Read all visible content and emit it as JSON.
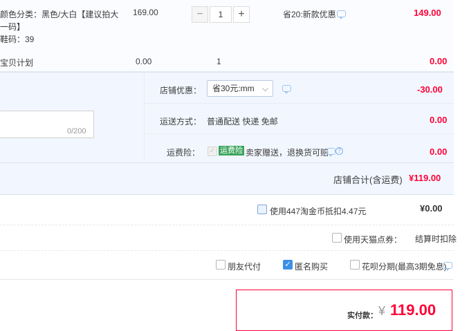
{
  "item": {
    "sku_line1": "颜色分类：黑色/大白【建议拍大",
    "sku_line2": "一码】",
    "sku_line3": "鞋码：39",
    "unit_price": "169.00",
    "quantity": "1",
    "minus": "−",
    "plus": "+",
    "promo": "省20:新款优惠",
    "subtotal": "149.00"
  },
  "insurance_plan": {
    "label": "宝贝计划",
    "price": "0.00",
    "qty": "1",
    "total": "0.00"
  },
  "shop": {
    "message_counter": "0/200",
    "discount_label": "店铺优惠：",
    "discount_select": "省30元:mm",
    "discount_value": "-30.00",
    "shipping_label": "运送方式：",
    "shipping_value": "普通配送 快递 免邮",
    "shipping_cost": "0.00",
    "freight_label": "运费险：",
    "freight_badge": "运费险",
    "freight_desc": "卖家赠送，退换货可赔",
    "freight_cost": "0.00",
    "total_label": "店铺合计(含运费)",
    "total_value": "¥119.00"
  },
  "coins": {
    "label": "使用447淘金币抵扣4.47元",
    "value": "¥0.00"
  },
  "tmall_points": {
    "label": "使用天猫点券：",
    "note": "结算时扣除"
  },
  "options": {
    "friend_pay": "朋友代付",
    "anonymous": "匿名购买",
    "installment": "花呗分期(最高3期免息)"
  },
  "payment": {
    "label": "实付款：",
    "currency": "¥",
    "amount": "119.00"
  },
  "colors": {
    "accent_red": "#ff0036",
    "light_blue_bg": "#f2f7ff",
    "check_blue": "#3b8fe6"
  }
}
